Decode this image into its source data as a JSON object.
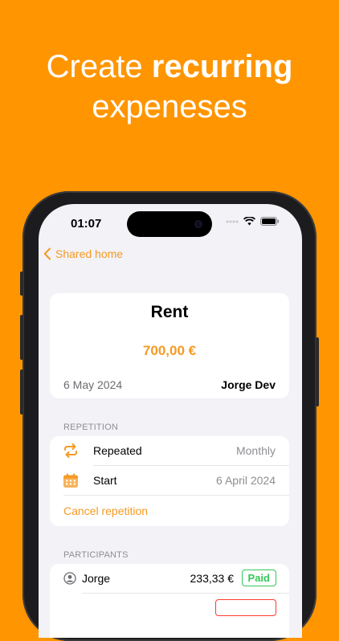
{
  "headline": {
    "line1_prefix": "Create ",
    "line1_bold": "recurring",
    "line2": "expeneses"
  },
  "status_bar": {
    "time": "01:07"
  },
  "nav": {
    "back_label": "Shared home"
  },
  "expense": {
    "title": "Rent",
    "amount": "700,00 €",
    "date": "6 May 2024",
    "owner": "Jorge Dev"
  },
  "repetition": {
    "section_label": "REPETITION",
    "repeated_label": "Repeated",
    "repeated_value": "Monthly",
    "start_label": "Start",
    "start_value": "6 April 2024",
    "cancel_label": "Cancel repetition"
  },
  "participants": {
    "section_label": "PARTICIPANTS",
    "items": [
      {
        "name": "Jorge",
        "amount": "233,33 €",
        "status": "Paid"
      }
    ]
  },
  "colors": {
    "background": "#FF9500",
    "accent": "#F59A23",
    "paid": "#34C759",
    "unpaid": "#FF3B30"
  },
  "icons": [
    "repeat-icon",
    "calendar-icon",
    "person-icon",
    "chevron-left-icon",
    "wifi-icon",
    "battery-icon",
    "signal-icon"
  ]
}
